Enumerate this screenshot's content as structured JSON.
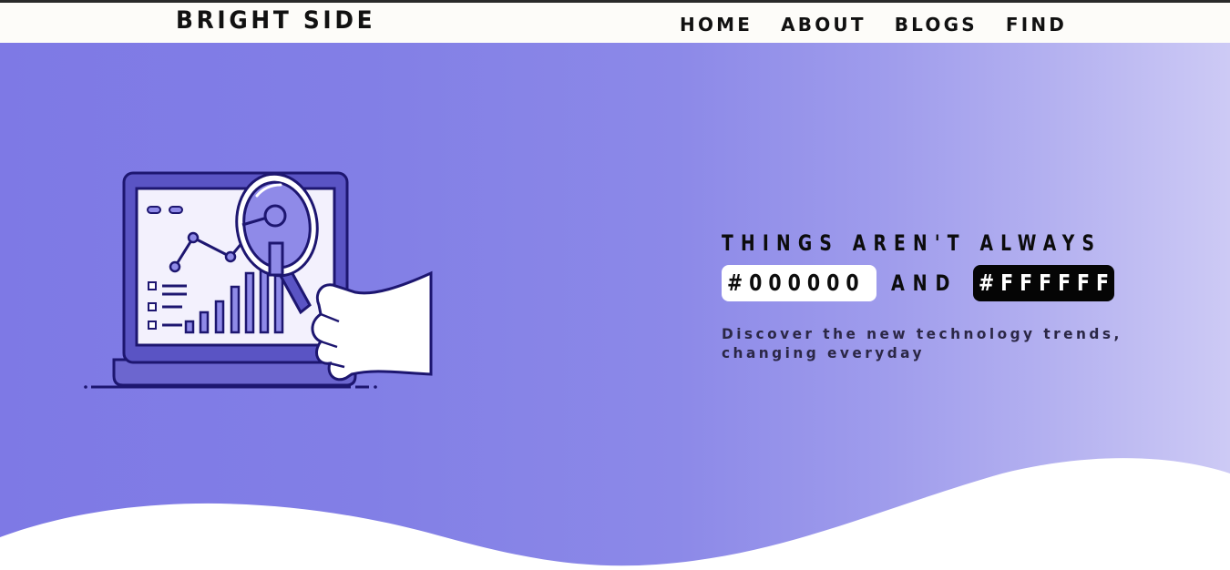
{
  "header": {
    "logo": "BRIGHT SIDE",
    "nav": [
      {
        "label": "HOME"
      },
      {
        "label": "ABOUT"
      },
      {
        "label": "BLOGS"
      },
      {
        "label": "FIND"
      }
    ]
  },
  "hero": {
    "headline_line1": "THINGS AREN'T ALWAYS",
    "chip_black": "#000000",
    "and_word": "AND",
    "chip_white": "#FFFFFF",
    "subtitle_line1": "Discover the new technology trends,",
    "subtitle_line2": "changing everyday",
    "illustration_icon": "laptop-magnifier-analytics-icon"
  },
  "colors": {
    "gradient_start": "#7e79e5",
    "gradient_end": "#cdcaf5",
    "nav_background": "#fdfcf9",
    "text_dark": "#0c0c0c"
  }
}
